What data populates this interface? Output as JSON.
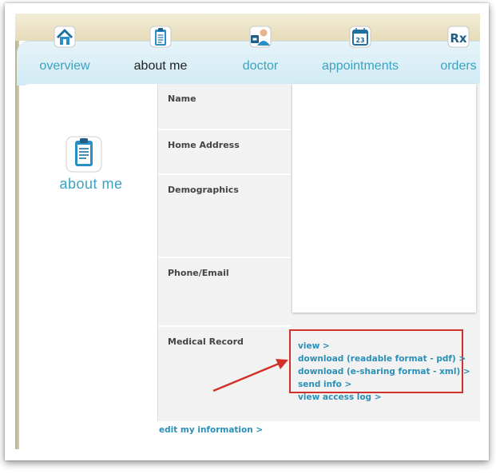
{
  "nav": {
    "tabs": [
      {
        "label": "overview",
        "icon": "house-icon"
      },
      {
        "label": "about me",
        "icon": "clipboard-icon",
        "active": true
      },
      {
        "label": "doctor",
        "icon": "doctor-icon"
      },
      {
        "label": "appointments",
        "icon": "calendar-icon",
        "date": "23"
      },
      {
        "label": "orders",
        "icon": "rx-icon",
        "glyph": "Rx"
      }
    ]
  },
  "sidebar": {
    "title": "about me",
    "icon": "clipboard-icon"
  },
  "form": {
    "fields": [
      {
        "label": "Name"
      },
      {
        "label": "Home Address"
      },
      {
        "label": "Demographics"
      },
      {
        "label": "Phone/Email"
      },
      {
        "label": "Medical Record"
      }
    ]
  },
  "medical_record": {
    "links": [
      "view >",
      "download (readable format - pdf) >",
      "download (e-sharing format - xml) >",
      "send info >",
      "view access log >"
    ]
  },
  "footer": {
    "edit_link": "edit my information >"
  },
  "colors": {
    "accent": "#3aa3c2",
    "link": "#2a8fb6",
    "highlight": "#d2302a"
  }
}
